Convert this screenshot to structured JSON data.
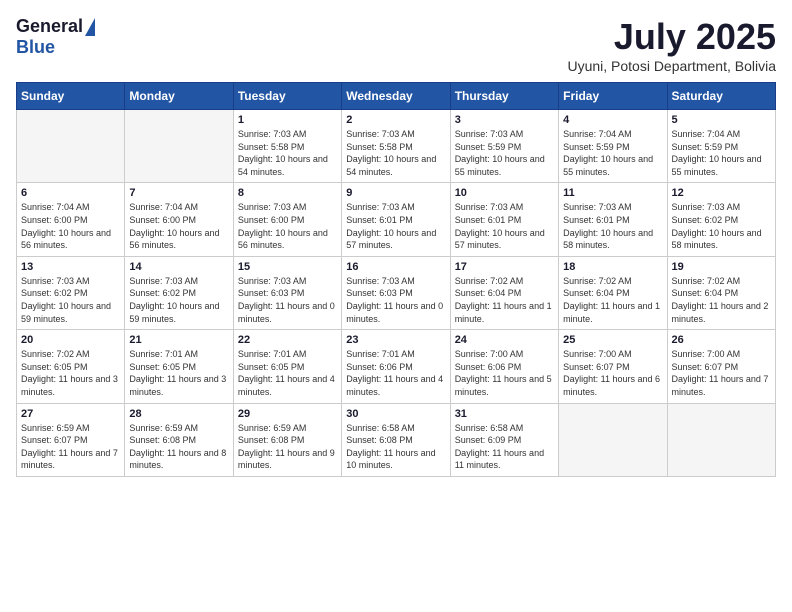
{
  "logo": {
    "general": "General",
    "blue": "Blue"
  },
  "title": "July 2025",
  "subtitle": "Uyuni, Potosi Department, Bolivia",
  "days_of_week": [
    "Sunday",
    "Monday",
    "Tuesday",
    "Wednesday",
    "Thursday",
    "Friday",
    "Saturday"
  ],
  "weeks": [
    [
      {
        "day": "",
        "info": ""
      },
      {
        "day": "",
        "info": ""
      },
      {
        "day": "1",
        "info": "Sunrise: 7:03 AM\nSunset: 5:58 PM\nDaylight: 10 hours and 54 minutes."
      },
      {
        "day": "2",
        "info": "Sunrise: 7:03 AM\nSunset: 5:58 PM\nDaylight: 10 hours and 54 minutes."
      },
      {
        "day": "3",
        "info": "Sunrise: 7:03 AM\nSunset: 5:59 PM\nDaylight: 10 hours and 55 minutes."
      },
      {
        "day": "4",
        "info": "Sunrise: 7:04 AM\nSunset: 5:59 PM\nDaylight: 10 hours and 55 minutes."
      },
      {
        "day": "5",
        "info": "Sunrise: 7:04 AM\nSunset: 5:59 PM\nDaylight: 10 hours and 55 minutes."
      }
    ],
    [
      {
        "day": "6",
        "info": "Sunrise: 7:04 AM\nSunset: 6:00 PM\nDaylight: 10 hours and 56 minutes."
      },
      {
        "day": "7",
        "info": "Sunrise: 7:04 AM\nSunset: 6:00 PM\nDaylight: 10 hours and 56 minutes."
      },
      {
        "day": "8",
        "info": "Sunrise: 7:03 AM\nSunset: 6:00 PM\nDaylight: 10 hours and 56 minutes."
      },
      {
        "day": "9",
        "info": "Sunrise: 7:03 AM\nSunset: 6:01 PM\nDaylight: 10 hours and 57 minutes."
      },
      {
        "day": "10",
        "info": "Sunrise: 7:03 AM\nSunset: 6:01 PM\nDaylight: 10 hours and 57 minutes."
      },
      {
        "day": "11",
        "info": "Sunrise: 7:03 AM\nSunset: 6:01 PM\nDaylight: 10 hours and 58 minutes."
      },
      {
        "day": "12",
        "info": "Sunrise: 7:03 AM\nSunset: 6:02 PM\nDaylight: 10 hours and 58 minutes."
      }
    ],
    [
      {
        "day": "13",
        "info": "Sunrise: 7:03 AM\nSunset: 6:02 PM\nDaylight: 10 hours and 59 minutes."
      },
      {
        "day": "14",
        "info": "Sunrise: 7:03 AM\nSunset: 6:02 PM\nDaylight: 10 hours and 59 minutes."
      },
      {
        "day": "15",
        "info": "Sunrise: 7:03 AM\nSunset: 6:03 PM\nDaylight: 11 hours and 0 minutes."
      },
      {
        "day": "16",
        "info": "Sunrise: 7:03 AM\nSunset: 6:03 PM\nDaylight: 11 hours and 0 minutes."
      },
      {
        "day": "17",
        "info": "Sunrise: 7:02 AM\nSunset: 6:04 PM\nDaylight: 11 hours and 1 minute."
      },
      {
        "day": "18",
        "info": "Sunrise: 7:02 AM\nSunset: 6:04 PM\nDaylight: 11 hours and 1 minute."
      },
      {
        "day": "19",
        "info": "Sunrise: 7:02 AM\nSunset: 6:04 PM\nDaylight: 11 hours and 2 minutes."
      }
    ],
    [
      {
        "day": "20",
        "info": "Sunrise: 7:02 AM\nSunset: 6:05 PM\nDaylight: 11 hours and 3 minutes."
      },
      {
        "day": "21",
        "info": "Sunrise: 7:01 AM\nSunset: 6:05 PM\nDaylight: 11 hours and 3 minutes."
      },
      {
        "day": "22",
        "info": "Sunrise: 7:01 AM\nSunset: 6:05 PM\nDaylight: 11 hours and 4 minutes."
      },
      {
        "day": "23",
        "info": "Sunrise: 7:01 AM\nSunset: 6:06 PM\nDaylight: 11 hours and 4 minutes."
      },
      {
        "day": "24",
        "info": "Sunrise: 7:00 AM\nSunset: 6:06 PM\nDaylight: 11 hours and 5 minutes."
      },
      {
        "day": "25",
        "info": "Sunrise: 7:00 AM\nSunset: 6:07 PM\nDaylight: 11 hours and 6 minutes."
      },
      {
        "day": "26",
        "info": "Sunrise: 7:00 AM\nSunset: 6:07 PM\nDaylight: 11 hours and 7 minutes."
      }
    ],
    [
      {
        "day": "27",
        "info": "Sunrise: 6:59 AM\nSunset: 6:07 PM\nDaylight: 11 hours and 7 minutes."
      },
      {
        "day": "28",
        "info": "Sunrise: 6:59 AM\nSunset: 6:08 PM\nDaylight: 11 hours and 8 minutes."
      },
      {
        "day": "29",
        "info": "Sunrise: 6:59 AM\nSunset: 6:08 PM\nDaylight: 11 hours and 9 minutes."
      },
      {
        "day": "30",
        "info": "Sunrise: 6:58 AM\nSunset: 6:08 PM\nDaylight: 11 hours and 10 minutes."
      },
      {
        "day": "31",
        "info": "Sunrise: 6:58 AM\nSunset: 6:09 PM\nDaylight: 11 hours and 11 minutes."
      },
      {
        "day": "",
        "info": ""
      },
      {
        "day": "",
        "info": ""
      }
    ]
  ]
}
